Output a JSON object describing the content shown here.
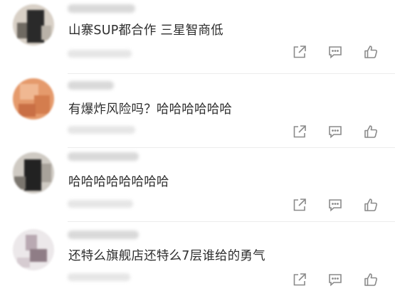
{
  "comments": [
    {
      "text": "山寨SUP都合作 三星智商低"
    },
    {
      "text": "有爆炸风险吗？哈哈哈哈哈哈"
    },
    {
      "text": "哈哈哈哈哈哈哈哈"
    },
    {
      "text": "还特么旗舰店还特么7层谁给的勇气"
    }
  ],
  "icons": {
    "share": "share-icon",
    "reply": "comment-icon",
    "like": "thumbs-up-icon"
  },
  "colors": {
    "background": "#ffffff",
    "text": "#2e2e2e",
    "icon": "#8a8a8a",
    "divider": "#ececec"
  }
}
